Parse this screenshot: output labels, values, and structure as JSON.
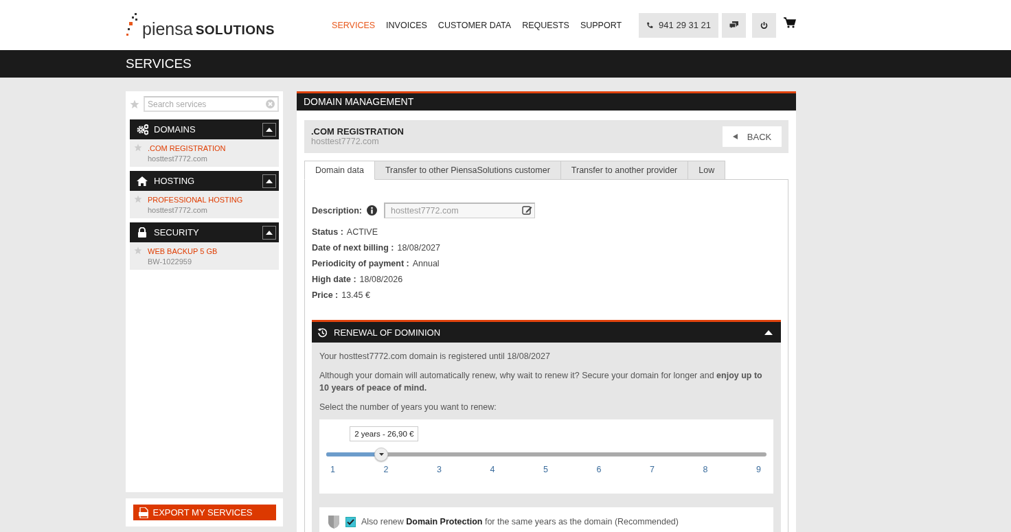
{
  "header": {
    "logo": {
      "light": "piensa",
      "bold": "SOLUTIONS"
    },
    "nav": [
      {
        "label": "SERVICES",
        "selected": true
      },
      {
        "label": "INVOICES",
        "selected": false
      },
      {
        "label": "CUSTOMER DATA",
        "selected": false
      },
      {
        "label": "REQUESTS",
        "selected": false
      },
      {
        "label": "SUPPORT",
        "selected": false
      }
    ],
    "phone": "941 29 31 21"
  },
  "page_title": "SERVICES",
  "sidebar": {
    "search": {
      "placeholder": "Search services"
    },
    "groups": [
      {
        "title": "DOMAINS",
        "expanded": true,
        "items": [
          {
            "name": ".COM REGISTRATION",
            "sub": "hosttest7772.com"
          }
        ]
      },
      {
        "title": "HOSTING",
        "expanded": true,
        "items": [
          {
            "name": "PROFESSIONAL HOSTING",
            "sub": "hosttest7772.com"
          }
        ]
      },
      {
        "title": "SECURITY",
        "expanded": true,
        "items": [
          {
            "name": "WEB BACKUP 5 GB",
            "sub": "BW-1022959"
          }
        ]
      }
    ],
    "export_button": "EXPORT MY SERVICES"
  },
  "main": {
    "title": "DOMAIN MANAGEMENT",
    "service": {
      "name": ".COM REGISTRATION",
      "domain": "hosttest7772.com"
    },
    "back_button": "BACK",
    "tabs": [
      {
        "label": "Domain data",
        "selected": true
      },
      {
        "label": "Transfer to other PiensaSolutions customer",
        "selected": false
      },
      {
        "label": "Transfer to another provider",
        "selected": false
      },
      {
        "label": "Low",
        "selected": false
      }
    ],
    "description": {
      "label": "Description:",
      "placeholder": "hosttest7772.com"
    },
    "details": [
      {
        "label": "Status :",
        "value": "ACTIVE"
      },
      {
        "label": "Date of next billing :",
        "value": "18/08/2027"
      },
      {
        "label": "Periodicity of payment :",
        "value": "Annual"
      },
      {
        "label": "High date :",
        "value": "18/08/2026"
      },
      {
        "label": "Price :",
        "value": "13.45 €"
      }
    ],
    "renewal": {
      "title": "RENEWAL OF DOMINION",
      "expanded": true,
      "text_1": "Your hosttest7772.com domain is registered until 18/08/2027",
      "text_2": "Although your domain will automatically renew, why wait to renew it? Secure your domain for longer and **enjoy up to 10 years of peace of mind.**",
      "prompt": "Select the number of years you want to renew:",
      "slider": {
        "tooltip": "2 years - 26,90 €",
        "level": 0.125,
        "ticks": [
          "1",
          "2",
          "3",
          "4",
          "5",
          "6",
          "7",
          "8",
          "9"
        ]
      },
      "protection": {
        "checked": true,
        "text": "Also renew **Domain Protection** for the same years as the domain (Recommended)"
      }
    }
  }
}
